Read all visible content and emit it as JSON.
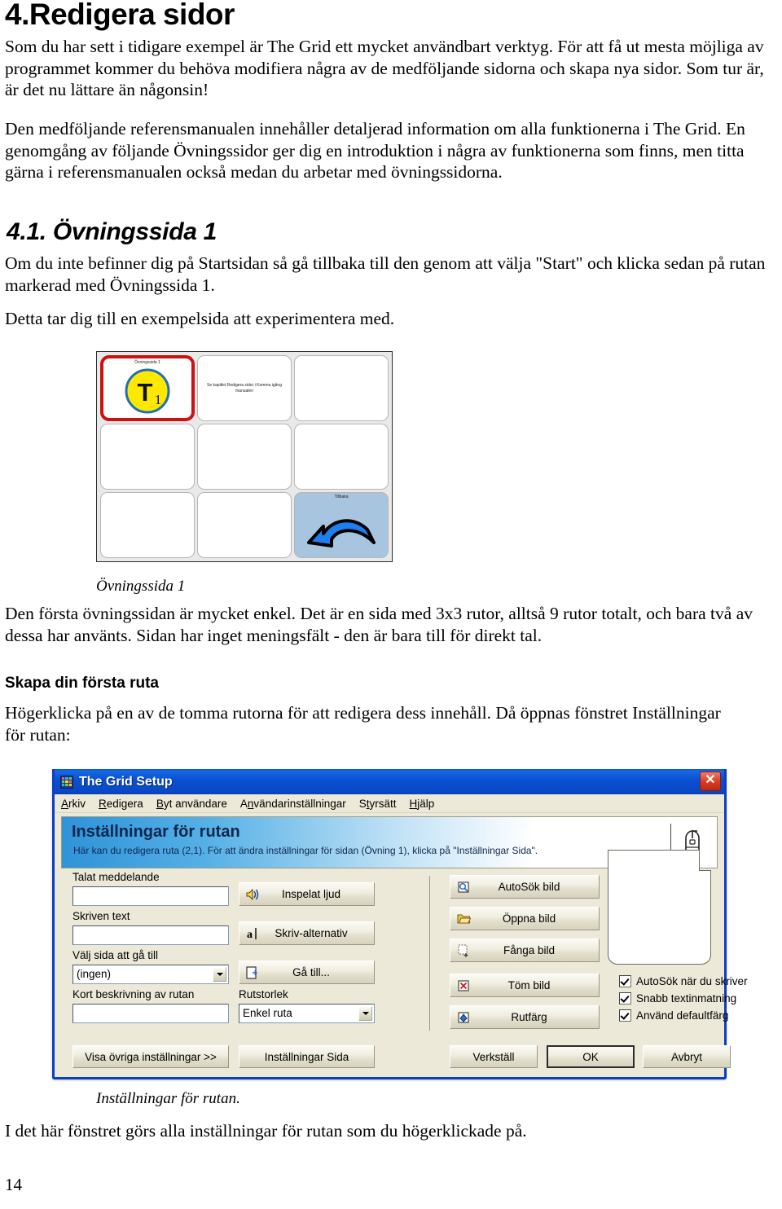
{
  "document": {
    "heading": "4.Redigera sidor",
    "paragraph_1": "Som du har sett i tidigare exempel är The Grid ett mycket användbart verktyg. För att få ut mesta möjliga av programmet kommer du behöva modifiera några av de medföljande sidorna och skapa nya sidor.  Som tur är, är det nu lättare än någonsin!",
    "paragraph_2": "Den medföljande referensmanualen innehåller detaljerad information om alla funktionerna i The Grid. En genomgång av följande Övningssidor ger dig en introduktion i några av funktionerna som finns, men titta gärna i referensmanualen också medan du arbetar med övningssidorna.",
    "subheading_1": "4.1. Övningssida 1",
    "paragraph_3": "Om du inte befinner dig på Startsidan så gå tillbaka till den genom att välja \"Start\" och klicka sedan på rutan markerad med Övningssida 1.",
    "paragraph_4": "Detta tar dig till en exempelsida att experimentera med.",
    "figure_1_caption": "Övningssida 1",
    "paragraph_5": "Den första övningssidan är mycket enkel. Det är en sida med 3x3 rutor, alltså 9 rutor totalt, och bara två av dessa har använts. Sidan har inget meningsfält - den är bara till för direkt tal.",
    "subheading_2": "Skapa din första ruta",
    "paragraph_6": "Högerklicka på en av de tomma rutorna för att redigera dess innehåll. Då öppnas fönstret Inställningar för rutan:",
    "figure_2_caption": "Inställningar för rutan.",
    "paragraph_7": "I det här fönstret görs alla inställningar för rutan som du högerklickade på.",
    "page_number": "14"
  },
  "grid_figure": {
    "cells": [
      {
        "label": "Övningssida 1",
        "text": "",
        "symbol": "t1-badge",
        "selected": true,
        "style": "white"
      },
      {
        "label": "",
        "text": "Se kapitlet Redigera sidor i Komma igång manualen",
        "symbol": "",
        "selected": false,
        "style": "white"
      },
      {
        "label": "",
        "text": "",
        "symbol": "",
        "selected": false,
        "style": "white"
      },
      {
        "label": "",
        "text": "",
        "symbol": "",
        "selected": false,
        "style": "white"
      },
      {
        "label": "",
        "text": "",
        "symbol": "",
        "selected": false,
        "style": "white"
      },
      {
        "label": "",
        "text": "",
        "symbol": "",
        "selected": false,
        "style": "white"
      },
      {
        "label": "",
        "text": "",
        "symbol": "",
        "selected": false,
        "style": "white"
      },
      {
        "label": "",
        "text": "",
        "symbol": "",
        "selected": false,
        "style": "white"
      },
      {
        "label": "Tillbaka",
        "text": "",
        "symbol": "back-arrow",
        "selected": false,
        "style": "blue"
      }
    ],
    "colors": {
      "selection": "#cc1111",
      "back_cell": "#a8c5e0",
      "badge_fill": "#ffe800",
      "badge_ring": "#1f6fb4",
      "arrow_fill": "#1f7ef0"
    },
    "badge_text": "T",
    "badge_sub": "1"
  },
  "dialog": {
    "title": "The Grid Setup",
    "close_label": "✕",
    "menu": [
      {
        "label": "Arkiv",
        "accel": "A"
      },
      {
        "label": "Redigera",
        "accel": "R"
      },
      {
        "label": "Byt användare",
        "accel": "B"
      },
      {
        "label": "Användarinställningar",
        "accel": "n"
      },
      {
        "label": "Styrsätt",
        "accel": "t"
      },
      {
        "label": "Hjälp",
        "accel": "H"
      }
    ],
    "banner": {
      "title": "Inställningar för rutan",
      "subtitle": "Här kan du redigera ruta (2,1). För att ändra inställningar för sidan (Övning 1), klicka på \"Inställningar Sida\"."
    },
    "fields": {
      "spoken_label": "Talat meddelande",
      "spoken_value": "",
      "written_label": "Skriven text",
      "written_value": "",
      "goto_label": "Välj sida att gå till",
      "goto_value": "(ingen)",
      "desc_label": "Kort beskrivning av rutan",
      "desc_value": "",
      "cellsize_label": "Rutstorlek",
      "cellsize_value": "Enkel ruta"
    },
    "left_buttons": [
      {
        "label": "Inspelat ljud",
        "icon": "speaker-icon",
        "accel": "I"
      },
      {
        "label": "Skriv-alternativ",
        "icon": "text-cursor-icon",
        "accel": "k"
      },
      {
        "label": "Gå till...",
        "icon": "goto-icon",
        "accel": "G"
      }
    ],
    "image_buttons": [
      {
        "label": "AutoSök bild",
        "icon": "magnifier-icon"
      },
      {
        "label": "Öppna bild",
        "icon": "folder-open-icon"
      },
      {
        "label": "Fånga bild",
        "icon": "capture-icon"
      },
      {
        "label": "Töm bild",
        "icon": "clear-image-icon"
      },
      {
        "label": "Rutfärg",
        "icon": "paint-bucket-icon"
      }
    ],
    "checkboxes": [
      {
        "label": "AutoSök när du skriver",
        "checked": true
      },
      {
        "label": "Snabb textinmatning",
        "checked": true
      },
      {
        "label": "Använd defaultfärg",
        "checked": true
      }
    ],
    "footer_buttons": [
      {
        "label": "Visa övriga inställningar >>",
        "default": false
      },
      {
        "label": "Inställningar Sida",
        "accel": "S",
        "default": false
      },
      {
        "label": "Verkställ",
        "accel": "V",
        "default": false
      },
      {
        "label": "OK",
        "accel": "O",
        "default": true
      },
      {
        "label": "Avbryt",
        "accel": "y",
        "default": false
      }
    ],
    "colors": {
      "titlebar": "#0a4fd0",
      "face": "#ece9d8",
      "banner_accent": "#2f93d8"
    }
  }
}
